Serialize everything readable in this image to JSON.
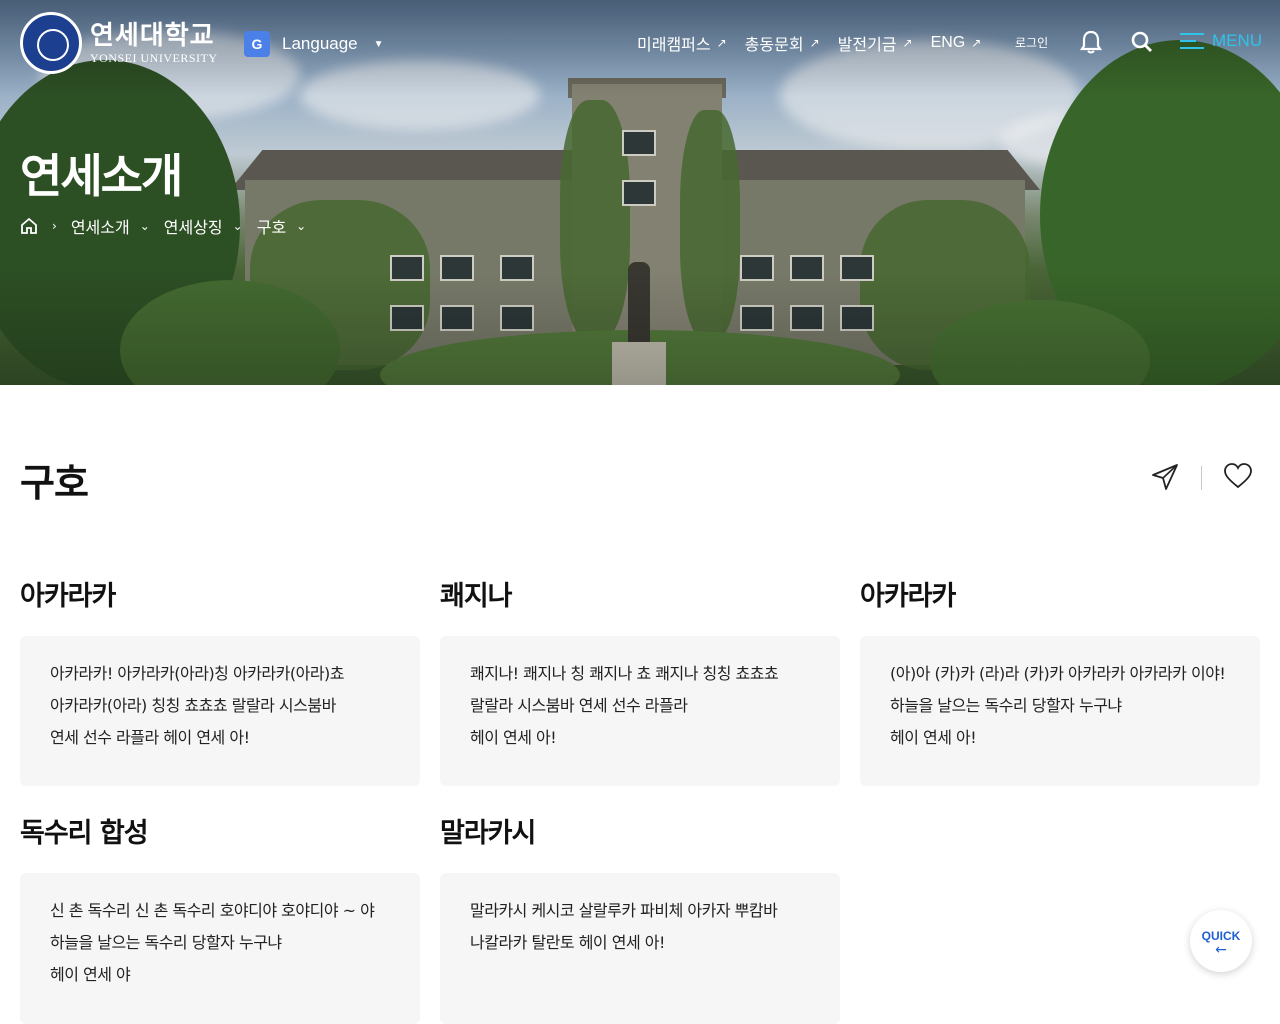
{
  "header": {
    "logo_kr": "연세대학교",
    "logo_en": "YONSEI UNIVERSITY",
    "language_label": "Language",
    "nav": [
      "미래캠퍼스",
      "총동문회",
      "발전기금",
      "ENG"
    ],
    "login_label": "로그인",
    "menu_label": "MENU",
    "accent_color": "#2fc3ea"
  },
  "hero": {
    "heading": "연세소개",
    "breadcrumb": [
      "연세소개",
      "연세상징",
      "구호"
    ]
  },
  "page": {
    "title": "구호"
  },
  "cheers": [
    {
      "title": "아카라카",
      "lines": [
        "아카라카! 아카라카(아라)칭 아카라카(아라)쵸",
        "아카라카(아라) 칭칭 쵸쵸쵸 랄랄라 시스붐바",
        "연세 선수 라플라 헤이 연세 아!"
      ]
    },
    {
      "title": "쾌지나",
      "lines": [
        "쾌지나! 쾌지나 칭 쾌지나 쵸 쾌지나 칭칭 쵸쵸쵸",
        "랄랄라 시스붐바 연세 선수 라플라",
        "헤이 연세 아!"
      ]
    },
    {
      "title": "아카라카",
      "lines": [
        "(아)아 (카)카 (라)라 (카)카 아카라카 아카라카 이야!",
        "하늘을 날으는 독수리 당할자 누구냐",
        "헤이 연세 아!"
      ]
    },
    {
      "title": "독수리 합성",
      "lines": [
        "신 촌 독수리 신 촌 독수리 호야디야 호야디야 ~ 야",
        "하늘을 날으는 독수리 당할자 누구냐",
        "헤이 연세 야"
      ]
    },
    {
      "title": "말라카시",
      "lines": [
        "말라카시 케시코 살랄루카 파비체 아카자 뿌캄바",
        "나칼라카 탈란토 헤이 연세 아!"
      ]
    }
  ],
  "quick": {
    "label": "QUICK",
    "arrow": "←",
    "color": "#1f5fd1"
  }
}
